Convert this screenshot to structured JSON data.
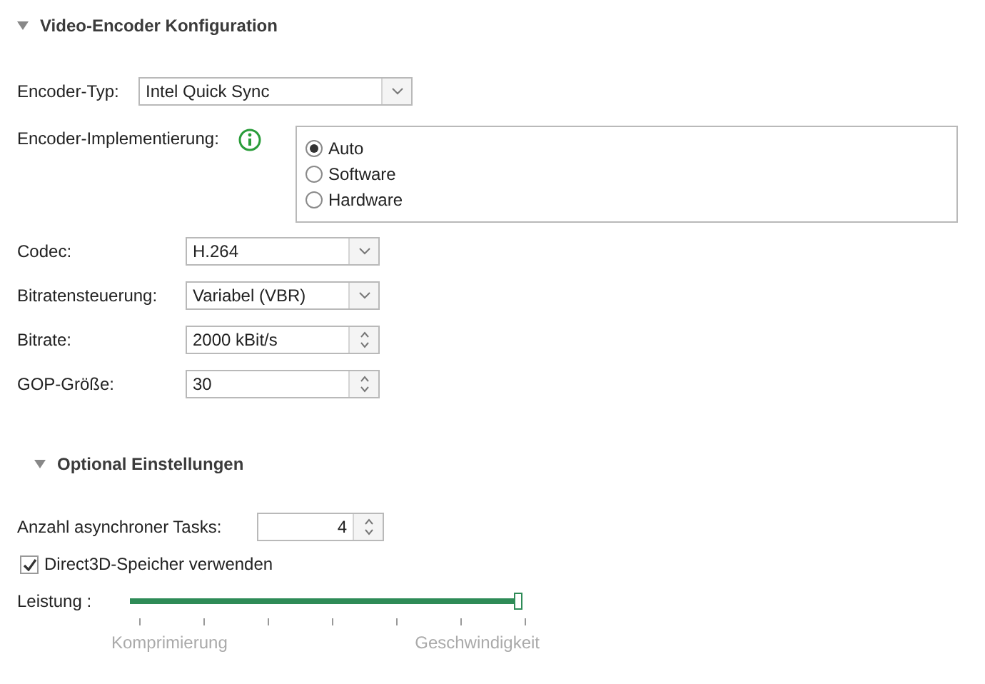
{
  "video_encoder": {
    "title": "Video-Encoder Konfiguration",
    "expanded": true,
    "encoder_type": {
      "label": "Encoder-Typ:",
      "value": "Intel Quick Sync"
    },
    "implementation": {
      "label": "Encoder-Implementierung:",
      "options": [
        {
          "label": "Auto",
          "selected": true
        },
        {
          "label": "Software",
          "selected": false
        },
        {
          "label": "Hardware",
          "selected": false
        }
      ]
    },
    "fields": [
      {
        "kind": "combo",
        "label": "Codec:",
        "value": "H.264"
      },
      {
        "kind": "combo",
        "label": "Bitratensteuerung:",
        "value": "Variabel (VBR)"
      },
      {
        "kind": "spin",
        "label": "Bitrate:",
        "value": "2000 kBit/s"
      },
      {
        "kind": "spin",
        "label": "GOP-Größe:",
        "value": "30"
      }
    ]
  },
  "optional": {
    "title": "Optional Einstellungen",
    "expanded": true,
    "async_tasks": {
      "label": "Anzahl asynchroner Tasks:",
      "value": "4"
    },
    "direct3d": {
      "label": "Direct3D-Speicher verwenden",
      "checked": true
    },
    "performance": {
      "label": "Leistung :",
      "level": 1,
      "min_label": "Komprimierung",
      "max_label": "Geschwindigkeit"
    }
  }
}
